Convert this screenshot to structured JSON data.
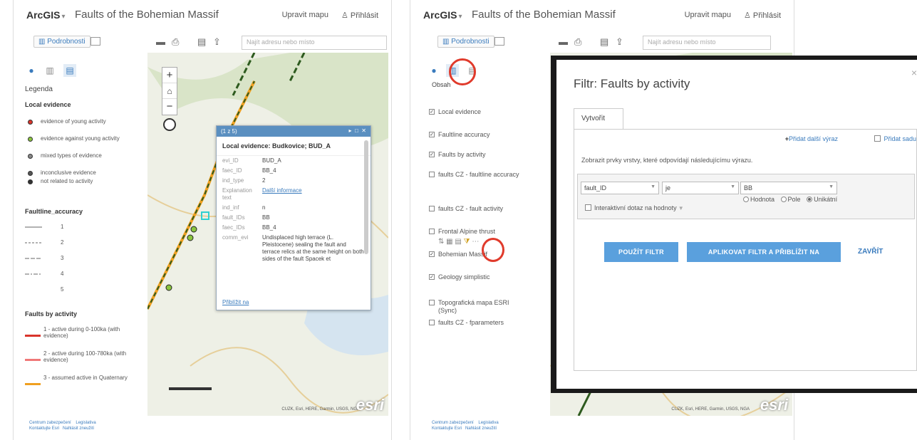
{
  "left": {
    "brand": "ArcGIS",
    "title": "Faults of the Bohemian Massif",
    "edit_map": "Upravit mapu",
    "login": "Přihlásit",
    "details_tab": "Podrobnosti",
    "search_placeholder": "Najít adresu nebo místo",
    "legend_title": "Legenda",
    "sections": {
      "local_evidence": "Local evidence",
      "faultline_accuracy": "Faultline_accuracy",
      "faults_by_activity": "Faults by activity"
    },
    "local_evidence_items": [
      {
        "label": "evidence of young activity",
        "color": "#d9342b"
      },
      {
        "label": "evidence against young activity",
        "color": "#8bc53f"
      },
      {
        "label": "mixed types of evidence",
        "color": "#888888"
      },
      {
        "label": "inconclusive evidence",
        "color": "#555555"
      },
      {
        "label": "not related to activity",
        "color": "#333333"
      }
    ],
    "accuracy_items": [
      "1",
      "2",
      "3",
      "4",
      "5"
    ],
    "activity_items": [
      {
        "label": "1 - active during 0-100ka (with evidence)",
        "color": "#d9342b"
      },
      {
        "label": "2 - active during 100-780ka (with evidence)",
        "color": "#f07878"
      },
      {
        "label": "3 - assumed active in Quaternary",
        "color": "#f0a020"
      }
    ],
    "footer": [
      "Centrum zabezpečení",
      "Legislativa",
      "Kontaktujte Esri",
      "Nahlásit zneužití"
    ],
    "popup": {
      "counter": "(1 z 5)",
      "title": "Local evidence: Budkovice; BUD_A",
      "fields": [
        {
          "key": "evi_ID",
          "value": "BUD_A"
        },
        {
          "key": "faec_ID",
          "value": "BB_4"
        },
        {
          "key": "ind_type",
          "value": "2"
        },
        {
          "key": "Explanation text",
          "value": "Další informace",
          "link": true
        },
        {
          "key": "ind_inf",
          "value": "n"
        },
        {
          "key": "fault_IDs",
          "value": "BB"
        },
        {
          "key": "faec_IDs",
          "value": "BB_4"
        },
        {
          "key": "comm_evi",
          "value": "Undisplaced high terrace (L. Pleistocene) sealing the fault and terrace relics at the same height on both sides of the fault Spacek et"
        }
      ],
      "zoom_link": "Přiblížit na"
    },
    "attribution": "CUZK, Esri, HERE, Garmin, USGS, NGA"
  },
  "right": {
    "brand": "ArcGIS",
    "title": "Faults of the Bohemian Massif",
    "edit_map": "Upravit mapu",
    "login": "Přihlásit",
    "details_tab": "Podrobnosti",
    "search_placeholder": "Najít adresu nebo místo",
    "content_label": "Obsah",
    "layers": [
      {
        "label": "Local evidence",
        "checked": true
      },
      {
        "label": "Faultline accuracy",
        "checked": true
      },
      {
        "label": "Faults by activity",
        "checked": true
      },
      {
        "label": "faults CZ - faultline accuracy",
        "checked": false
      },
      {
        "label": "faults CZ - fault activity",
        "checked": false
      },
      {
        "label": "Frontal Alpine thrust",
        "checked": false
      },
      {
        "label": "Bohemian Massif",
        "checked": true
      },
      {
        "label": "Geology simplistic",
        "checked": true
      },
      {
        "label": "Topografická mapa ESRI (Sync)",
        "checked": false
      },
      {
        "label": "faults CZ - fparameters",
        "checked": false
      }
    ],
    "footer": [
      "Centrum zabezpečení",
      "Legislativa",
      "Kontaktujte Esri",
      "Nahlásit zneužití"
    ],
    "attribution": "CUZK, Esri, HERE, Garmin, USGS, NGA"
  },
  "dialog": {
    "title": "Filtr: Faults by activity",
    "close": "×",
    "tab": "Vytvořit",
    "add_expression": "Přidat další výraz",
    "add_set": "Přidat sadu",
    "description": "Zobrazit prvky vrstvy, které odpovídají následujícímu výrazu.",
    "field": "fault_ID",
    "operator": "je",
    "value": "BB",
    "radio_value": "Hodnota",
    "radio_field": "Pole",
    "radio_unique": "Unikátní",
    "interactive": "Interaktivní dotaz na hodnoty",
    "apply": "POUŽÍT FILTR",
    "apply_zoom": "APLIKOVAT FILTR A PŘIBLÍŽIT NA",
    "close_btn": "ZAVŘÍT"
  },
  "colors": {
    "accent": "#3a7bbd",
    "button": "#5aa0dd",
    "highlight": "#e03a2b"
  }
}
